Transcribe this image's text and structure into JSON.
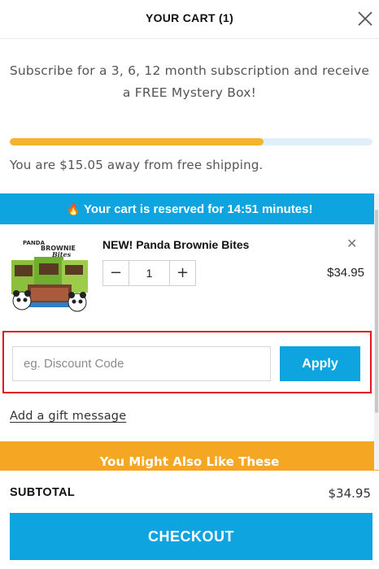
{
  "header": {
    "title": "YOUR CART (1)",
    "close_icon": "close-icon"
  },
  "subscribe": {
    "line1": "Subscribe for a 3, 6, 12 month subscription and receive",
    "line2": "a FREE Mystery Box!"
  },
  "shipping": {
    "progress_fraction": 0.7,
    "message": "You are $15.05 away from free shipping."
  },
  "reserve": {
    "icon": "fire-icon",
    "message": "Your cart is reserved for 14:51 minutes!"
  },
  "item": {
    "name": "NEW! Panda Brownie Bites",
    "quantity": "1",
    "price": "$34.95",
    "remove_icon": "close-icon",
    "minus_label": "−",
    "plus_label": "+",
    "thumb_text": "PANDA BROWNIE Bites"
  },
  "discount": {
    "placeholder": "eg. Discount Code",
    "value": "",
    "apply_label": "Apply"
  },
  "gift": {
    "label": "Add a gift message"
  },
  "upsell": {
    "title": "You Might Also Like These"
  },
  "footer": {
    "subtotal_label": "SUBTOTAL",
    "subtotal_value": "$34.95",
    "checkout_label": "CHECKOUT"
  },
  "colors": {
    "accent": "#0ea4e0",
    "progress": "#f5b330",
    "upsell": "#f5a623",
    "highlight": "#e3161b"
  }
}
